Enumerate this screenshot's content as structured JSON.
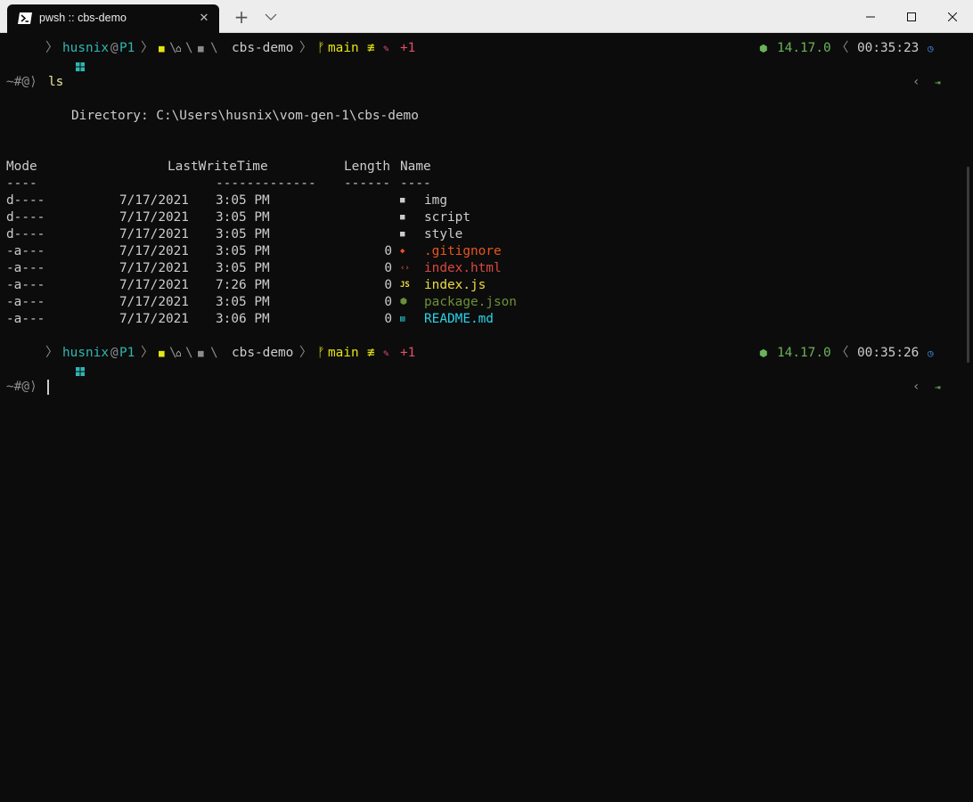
{
  "window": {
    "tab_title": "pwsh :: cbs-demo",
    "tab_icon": "powershell-icon",
    "new_tab_label": "+",
    "controls": [
      "minimize-icon",
      "maximize-icon",
      "close-icon"
    ]
  },
  "prompt_top": {
    "user": "husnix",
    "at": "@",
    "host": "P1",
    "path_dir": "cbs-demo",
    "git_icon": "",
    "git_branch": "main",
    "git_status_neq": "≢",
    "git_changes": "+1",
    "node_version": "14.17.0",
    "time": "00:35:23"
  },
  "prompt_bottom": {
    "user": "husnix",
    "at": "@",
    "host": "P1",
    "path_dir": "cbs-demo",
    "git_icon": "",
    "git_branch": "main",
    "git_status_neq": "≢",
    "git_changes": "+1",
    "node_version": "14.17.0",
    "time": "00:35:26"
  },
  "command_line_1": {
    "prompt": "~#@⟩",
    "command": "ls"
  },
  "command_line_2": {
    "prompt": "~#@⟩",
    "command": ""
  },
  "directory_header": "Directory: C:\\Users\\husnix\\vom-gen-1\\cbs-demo",
  "columns": {
    "mode": "Mode",
    "time": "LastWriteTime",
    "length": "Length",
    "name": "Name",
    "mode_ul": "----",
    "time_ul": "-------------",
    "length_ul": "------",
    "name_ul": "----"
  },
  "entries": [
    {
      "mode": "d----",
      "date": "7/17/2021",
      "time": "3:05 PM",
      "length": "",
      "icon": "folder-icon",
      "name": "img",
      "color": "#cccccc"
    },
    {
      "mode": "d----",
      "date": "7/17/2021",
      "time": "3:05 PM",
      "length": "",
      "icon": "folder-icon",
      "name": "script",
      "color": "#cccccc"
    },
    {
      "mode": "d----",
      "date": "7/17/2021",
      "time": "3:05 PM",
      "length": "",
      "icon": "folder-icon",
      "name": "style",
      "color": "#cccccc"
    },
    {
      "mode": "-a---",
      "date": "7/17/2021",
      "time": "3:05 PM",
      "length": "0",
      "icon": "git-icon",
      "name": ".gitignore",
      "color": "#e8551f"
    },
    {
      "mode": "-a---",
      "date": "7/17/2021",
      "time": "3:05 PM",
      "length": "0",
      "icon": "html-icon",
      "name": "index.html",
      "color": "#d8483f"
    },
    {
      "mode": "-a---",
      "date": "7/17/2021",
      "time": "7:26 PM",
      "length": "0",
      "icon": "js-icon",
      "name": "index.js",
      "color": "#eddb41"
    },
    {
      "mode": "-a---",
      "date": "7/17/2021",
      "time": "3:05 PM",
      "length": "0",
      "icon": "nodejs-icon",
      "name": "package.json",
      "color": "#6e8f3a"
    },
    {
      "mode": "-a---",
      "date": "7/17/2021",
      "time": "3:06 PM",
      "length": "0",
      "icon": "markdown-icon",
      "name": "README.md",
      "color": "#29d3e8"
    }
  ]
}
